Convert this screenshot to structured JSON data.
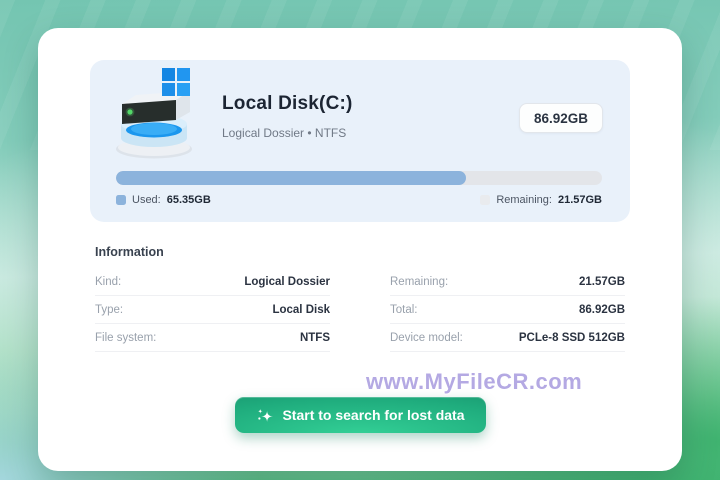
{
  "disk_card": {
    "title": "Local Disk(C:)",
    "subtitle": "Logical Dossier • NTFS",
    "size_badge": "86.92GB",
    "progress_percent": 72,
    "used_label": "Used:",
    "used_value": "65.35GB",
    "remaining_label": "Remaining:",
    "remaining_value": "21.57GB",
    "colors": {
      "used": "#8cb3dc",
      "remaining": "#e9ebee"
    }
  },
  "information": {
    "heading": "Information",
    "rows_left": [
      {
        "label": "Kind:",
        "value": "Logical Dossier"
      },
      {
        "label": "Type:",
        "value": "Local Disk"
      },
      {
        "label": "File system:",
        "value": "NTFS"
      }
    ],
    "rows_right": [
      {
        "label": "Remaining:",
        "value": "21.57GB"
      },
      {
        "label": "Total:",
        "value": "86.92GB"
      },
      {
        "label": "Device model:",
        "value": "PCLe-8 SSD 512GB"
      }
    ]
  },
  "action": {
    "button_label": "Start to search for lost data",
    "accent": "#1fac7d"
  },
  "watermark": {
    "text": "www.MyFileCR.com",
    "color": "#b4a9e3"
  },
  "icons": {
    "disk": "disk-3d-icon",
    "windows": "windows-logo-icon",
    "sparkle": "sparkle-icon"
  }
}
